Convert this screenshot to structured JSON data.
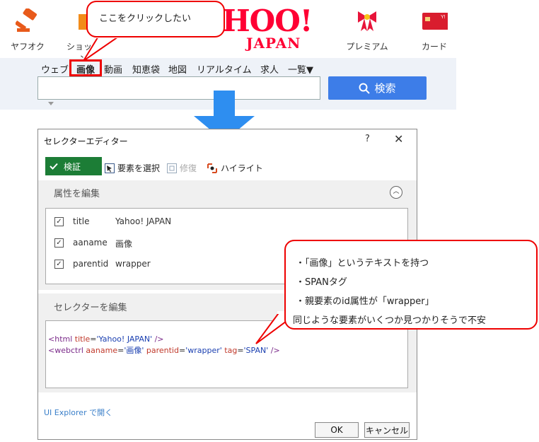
{
  "header": {
    "icons": {
      "auction": "ヤフオク",
      "shopping": "ショッピン",
      "premium": "プレミアム",
      "card": "カード"
    },
    "logo": {
      "main": "HOO!",
      "sub": "JAPAN"
    },
    "card_badge": "Y!"
  },
  "search": {
    "tabs": [
      "ウェブ",
      "画像",
      "動画",
      "知恵袋",
      "地図",
      "リアルタイム",
      "求人",
      "一覧▼"
    ],
    "button_label": "検索",
    "query_value": ""
  },
  "callout_top": {
    "text": "ここをクリックしたい"
  },
  "dialog": {
    "title": "セレクターエディター",
    "help_label": "?",
    "close_label": "✕",
    "validate_label": "検証",
    "toolbar": {
      "select_element": "要素を選択",
      "repair": "修復",
      "highlight": "ハイライト"
    },
    "edit_attributes_label": "属性を編集",
    "attributes": [
      {
        "name": "title",
        "value": "Yahoo! JAPAN",
        "checked": true
      },
      {
        "name": "aaname",
        "value": "画像",
        "checked": true
      },
      {
        "name": "parentid",
        "value": "wrapper",
        "checked": true
      }
    ],
    "edit_selector_label": "セレクターを編集",
    "selector_lines": [
      {
        "tag_open": "<html ",
        "attrs": [
          {
            "n": "title",
            "v": "'Yahoo! JAPAN'"
          }
        ],
        "tag_close": " />"
      },
      {
        "tag_open": "<webctrl ",
        "attrs": [
          {
            "n": "aaname",
            "v": "'画像'"
          },
          {
            "n": "parentid",
            "v": "'wrapper'"
          },
          {
            "n": "tag",
            "v": "'SPAN'"
          }
        ],
        "tag_close": " />"
      }
    ],
    "ui_explorer_link": "UI Explorer で開く",
    "ok_label": "OK",
    "cancel_label": "キャンセル"
  },
  "callout_note": {
    "lines": [
      "・「画像」というテキストを持つ",
      "・SPANタグ",
      "・親要素のid属性が「wrapper」",
      "同じような要素がいくつか見つかりそうで不安"
    ]
  },
  "colors": {
    "accent_red": "#e00000",
    "search_blue": "#3d7de8",
    "validate_green": "#1c7d36",
    "arrow_blue": "#2e8ef0"
  }
}
